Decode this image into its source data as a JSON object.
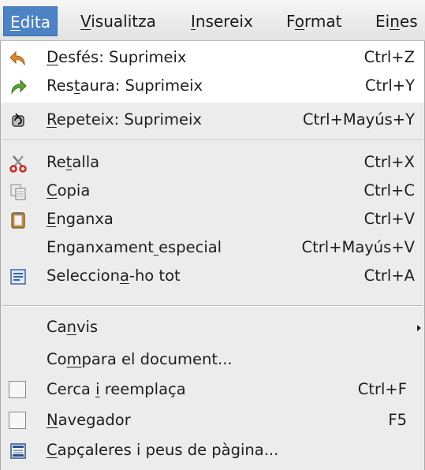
{
  "menubar": {
    "items": [
      {
        "text": "Edita",
        "mnemonic_index": 0,
        "active": true
      },
      {
        "text": "Visualitza",
        "mnemonic_index": 0
      },
      {
        "text": "Insereix",
        "mnemonic_index": 0
      },
      {
        "text": "Format",
        "mnemonic_index": 1
      },
      {
        "text": "Eines",
        "mnemonic_index": 2
      }
    ]
  },
  "menu": {
    "items": [
      {
        "label": "Desfés: Suprimeix",
        "mnemonic_index": 0,
        "shortcut": "Ctrl+Z",
        "icon": "undo-icon"
      },
      {
        "label": "Restaura: Suprimeix",
        "mnemonic_index": 3,
        "shortcut": "Ctrl+Y",
        "icon": "redo-icon"
      },
      {
        "label": "Repeteix: Suprimeix",
        "mnemonic_index": 0,
        "shortcut": "Ctrl+Mayús+Y",
        "icon": "repeat-icon"
      },
      {
        "label": "Retalla",
        "mnemonic_index": 2,
        "shortcut": "Ctrl+X",
        "icon": "scissors-icon"
      },
      {
        "label": "Copia",
        "mnemonic_index": 0,
        "shortcut": "Ctrl+C",
        "icon": "copy-icon"
      },
      {
        "label": "Enganxa",
        "mnemonic_index": 0,
        "shortcut": "Ctrl+V",
        "icon": "paste-icon"
      },
      {
        "label": "Enganxament especial",
        "mnemonic_index": 11,
        "shortcut": "Ctrl+Mayús+V",
        "icon": ""
      },
      {
        "label": "Selecciona-ho tot",
        "mnemonic_index": 9,
        "shortcut": "Ctrl+A",
        "icon": "select-all-icon"
      },
      {
        "label": "Canvis",
        "mnemonic_index": 2,
        "shortcut": "",
        "icon": "",
        "submenu": true
      },
      {
        "label": "Compara el document...",
        "mnemonic_index": 2,
        "shortcut": "",
        "icon": ""
      },
      {
        "label": "Cerca i reemplaça",
        "mnemonic_index": 6,
        "shortcut": "Ctrl+F",
        "icon": "checkbox"
      },
      {
        "label": "Navegador",
        "mnemonic_index": 0,
        "shortcut": "F5",
        "icon": "checkbox"
      },
      {
        "label": "Capçaleres i peus de pàgina...",
        "mnemonic_index": 0,
        "shortcut": "",
        "icon": "header-footer-icon"
      }
    ]
  },
  "colors": {
    "menubar_active": "#4b83c4",
    "menu_background": "#ececec",
    "hover_background": "#ffffff",
    "undo_icon": "#e08a2c",
    "redo_icon": "#5aa632",
    "paste_icon": "#c98a2e",
    "select_icon": "#3a66a8"
  }
}
